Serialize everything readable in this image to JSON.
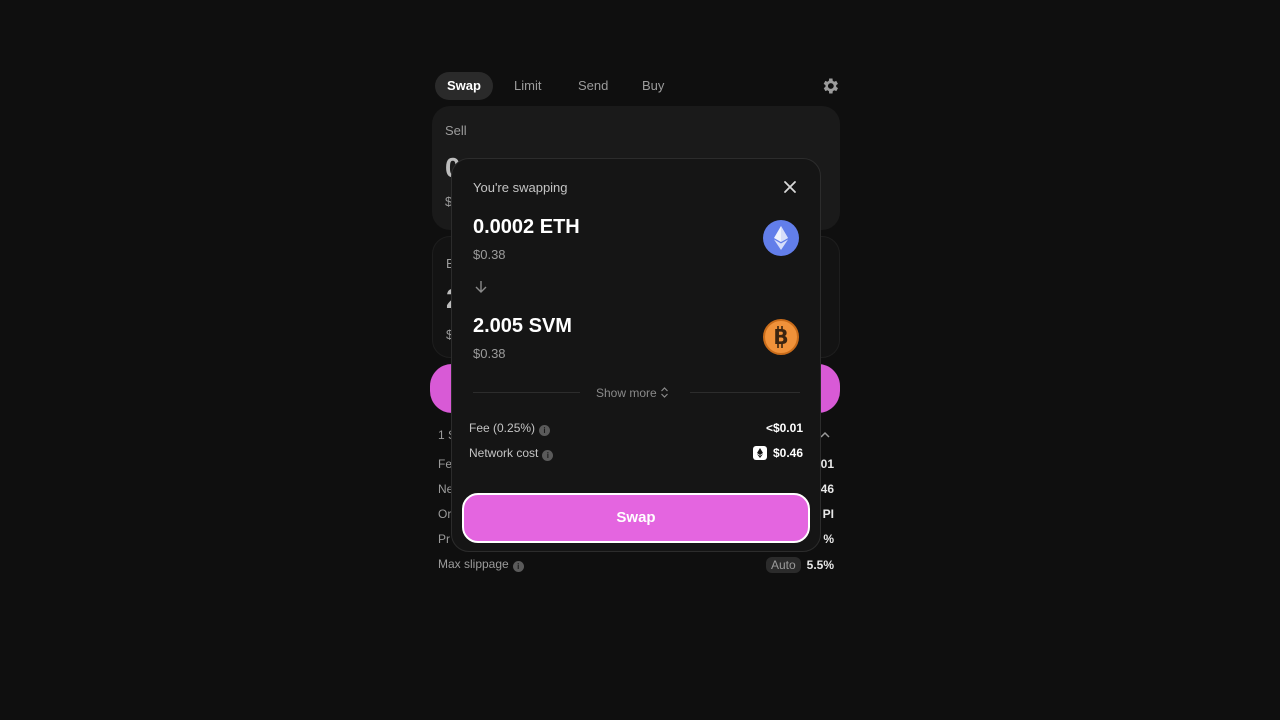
{
  "tabs": [
    {
      "label": "Swap",
      "active": true
    },
    {
      "label": "Limit",
      "active": false
    },
    {
      "label": "Send",
      "active": false
    },
    {
      "label": "Buy",
      "active": false
    }
  ],
  "background": {
    "sell_label": "Sell",
    "sell_amount_partial": "0",
    "sell_usd_partial": "$",
    "buy_label_partial": "B",
    "buy_amount_partial": "2",
    "buy_usd_partial": "$",
    "rate_partial": "1 S",
    "info_rows": [
      {
        "label": "Fe",
        "value": "01"
      },
      {
        "label": "Ne",
        "value": "46"
      },
      {
        "label": "Or",
        "value": "PI"
      },
      {
        "label": "Pr",
        "value": "%"
      }
    ],
    "max_slippage": {
      "label": "Max slippage",
      "pill": "Auto",
      "value": "5.5%"
    }
  },
  "modal": {
    "title": "You're swapping",
    "from": {
      "amount": "0.0002 ETH",
      "usd": "$0.38",
      "icon": "ethereum-icon",
      "color": "#627eea"
    },
    "to": {
      "amount": "2.005 SVM",
      "usd": "$0.38",
      "icon": "bitcoin-icon",
      "color": "#f0923a"
    },
    "show_more": "Show more",
    "fee": {
      "label": "Fee (0.25%)",
      "value": "<$0.01"
    },
    "network_cost": {
      "label": "Network cost",
      "value": "$0.46"
    },
    "swap_button": "Swap"
  },
  "colors": {
    "accent": "#e465e0",
    "background": "#0f0f0f",
    "panel": "#151515"
  }
}
